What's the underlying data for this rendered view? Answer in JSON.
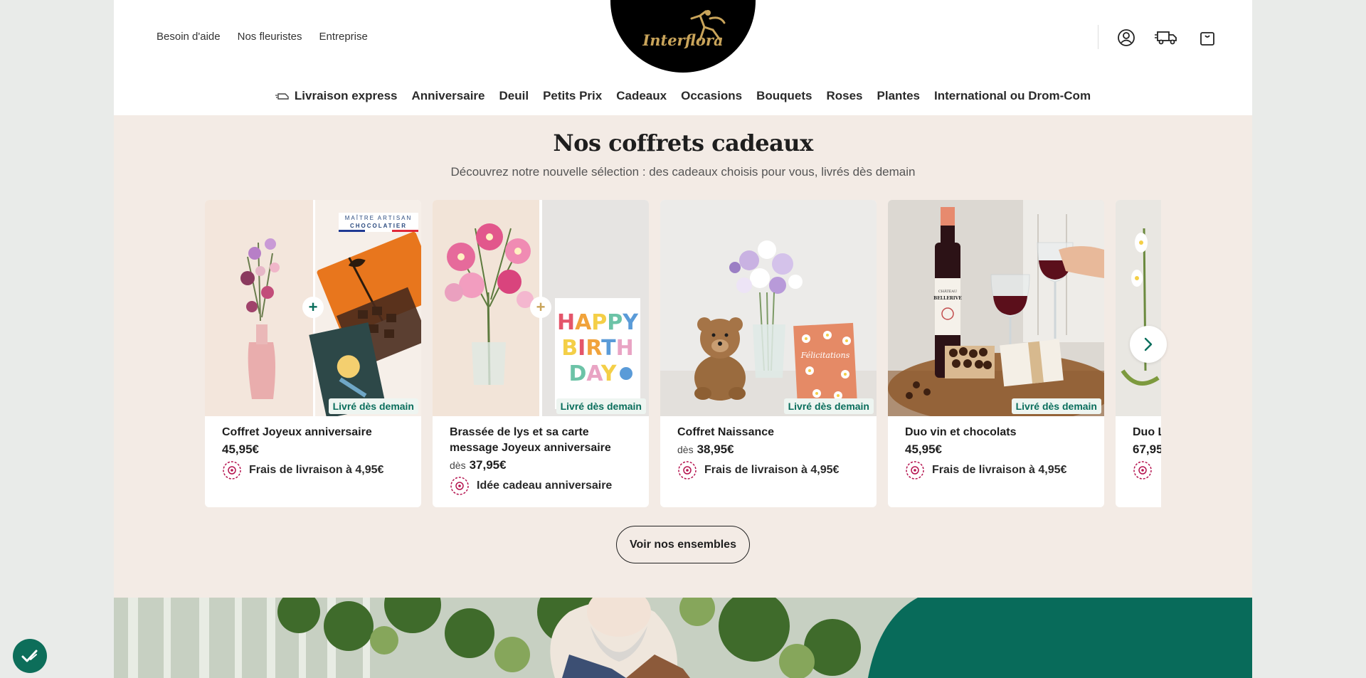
{
  "header": {
    "util_links": [
      "Besoin d'aide",
      "Nos fleuristes",
      "Entreprise"
    ],
    "logo_text": "Interflora",
    "icons": [
      "account-icon",
      "delivery-truck-icon",
      "cart-icon"
    ]
  },
  "nav": {
    "items": [
      "Livraison express",
      "Anniversaire",
      "Deuil",
      "Petits Prix",
      "Cadeaux",
      "Occasions",
      "Bouquets",
      "Roses",
      "Plantes",
      "International ou Drom-Com"
    ]
  },
  "section": {
    "title": "Nos coffrets cadeaux",
    "subtitle": "Découvrez notre nouvelle sélection : des cadeaux choisis pour vous, livrés dès demain",
    "cta": "Voir nos ensembles"
  },
  "products": [
    {
      "title": "Coffret Joyeux anniversaire",
      "from": "",
      "price": "45,95€",
      "promo": "Frais de livraison à 4,95€",
      "badge": "Livré dès demain",
      "overlay_text": "MAÎTRE ARTISAN CHOCOLATIER"
    },
    {
      "title": "Brassée de lys et sa carte message Joyeux anniversaire",
      "from": "dès",
      "price": "37,95€",
      "promo": "Idée cadeau anniversaire",
      "badge": "Livré dès demain",
      "overlay_text": "HAPPY BIRTH DAY"
    },
    {
      "title": "Coffret Naissance",
      "from": "dès",
      "price": "38,95€",
      "promo": "Frais de livraison à 4,95€",
      "badge": "Livré dès demain",
      "overlay_text": "Félicitations"
    },
    {
      "title": "Duo vin et chocolats",
      "from": "",
      "price": "45,95€",
      "promo": "Frais de livraison à 4,95€",
      "badge": "Livré dès demain",
      "overlay_text": "CHÂTEAU BELLERIVE"
    },
    {
      "title": "Duo L",
      "from": "",
      "price": "67,95",
      "promo": "",
      "badge": "",
      "overlay_text": ""
    }
  ],
  "colors": {
    "accent_green": "#0a6e5c",
    "brand_gold": "#c9a45a",
    "section_bg": "#f3ebe5",
    "promo_pink": "#b5134f"
  }
}
